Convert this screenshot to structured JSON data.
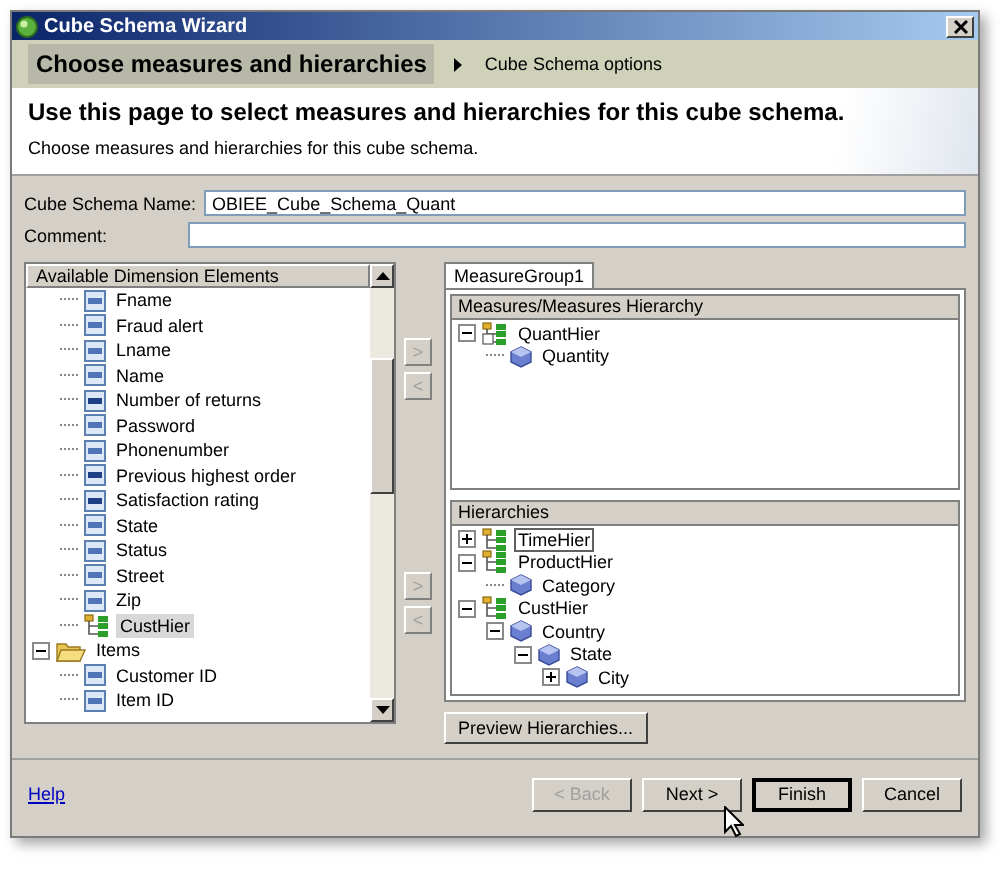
{
  "window": {
    "title": "Cube Schema Wizard"
  },
  "steps": [
    {
      "label": "Choose measures and hierarchies",
      "selected": true
    },
    {
      "label": "Cube Schema options",
      "selected": false
    }
  ],
  "header": {
    "title": "Use this page to select measures and hierarchies for this cube schema.",
    "description": "Choose measures and hierarchies for this cube schema."
  },
  "form": {
    "name_label": "Cube Schema Name:",
    "name_value": "OBIEE_Cube_Schema_Quant",
    "comment_label": "Comment:"
  },
  "available": {
    "header": "Available Dimension Elements",
    "tree": [
      {
        "children": [
          {
            "label": "Fname",
            "kind": "attribute",
            "selected": false
          },
          {
            "label": "Fraud alert",
            "kind": "attribute",
            "selected": false
          },
          {
            "label": "Lname",
            "kind": "attribute",
            "selected": false
          },
          {
            "label": "Name",
            "kind": "attribute",
            "selected": false
          },
          {
            "label": "Number of returns",
            "kind": "number",
            "selected": false
          },
          {
            "label": "Password",
            "kind": "attribute",
            "selected": false
          },
          {
            "label": "Phonenumber",
            "kind": "attribute",
            "selected": false
          },
          {
            "label": "Previous highest order",
            "kind": "number",
            "selected": false
          },
          {
            "label": "Satisfaction rating",
            "kind": "number",
            "selected": false
          },
          {
            "label": "State",
            "kind": "attribute",
            "selected": false
          },
          {
            "label": "Status",
            "kind": "attribute",
            "selected": false
          },
          {
            "label": "Street",
            "kind": "attribute",
            "selected": false
          },
          {
            "label": "Zip",
            "kind": "attribute",
            "selected": false
          },
          {
            "label": "CustHier",
            "kind": "hierarchy",
            "selected": true
          }
        ]
      },
      {
        "label": "Items",
        "kind": "folder",
        "expanded": true,
        "selected": false,
        "children": [
          {
            "label": "Customer ID",
            "kind": "attribute",
            "selected": false
          },
          {
            "label": "Item ID",
            "kind": "attribute",
            "selected": false
          }
        ]
      }
    ]
  },
  "transfer_buttons": [
    [
      {
        "label": ">",
        "disabled": true
      },
      {
        "label": "<",
        "disabled": true
      }
    ],
    [
      {
        "label": ">",
        "disabled": true
      },
      {
        "label": "<",
        "disabled": true
      }
    ]
  ],
  "tabs": [
    {
      "label": "MeasureGroup1",
      "selected": true
    }
  ],
  "measures": {
    "header": "Measures/Measures Hierarchy",
    "tree": [
      {
        "label": "QuantHier",
        "kind": "measure-hierarchy",
        "expanded": true,
        "children": [
          {
            "label": "Quantity",
            "kind": "cube"
          }
        ]
      }
    ]
  },
  "hierarchies": {
    "header": "Hierarchies",
    "tree": [
      {
        "label": "TimeHier",
        "kind": "hierarchy",
        "expanded": false,
        "selected": true
      },
      {
        "label": "ProductHier",
        "kind": "hierarchy",
        "expanded": true,
        "selected": false,
        "children": [
          {
            "label": "Category",
            "kind": "cube",
            "selected": false
          }
        ]
      },
      {
        "label": "CustHier",
        "kind": "hierarchy",
        "expanded": true,
        "selected": false,
        "children": [
          {
            "label": "Country",
            "kind": "cube",
            "expanded": true,
            "selected": false,
            "children": [
              {
                "label": "State",
                "kind": "cube",
                "expanded": true,
                "selected": false,
                "children": [
                  {
                    "label": "City",
                    "kind": "cube",
                    "expanded": false,
                    "selected": false
                  }
                ]
              }
            ]
          }
        ]
      }
    ]
  },
  "preview_button": "Preview Hierarchies...",
  "footer": {
    "help": "Help",
    "buttons": [
      {
        "label": "< Back",
        "disabled": true,
        "default": false
      },
      {
        "label": "Next >",
        "disabled": false,
        "default": false
      },
      {
        "label": "Finish",
        "disabled": false,
        "default": true
      },
      {
        "label": "Cancel",
        "disabled": false,
        "default": false
      }
    ]
  }
}
